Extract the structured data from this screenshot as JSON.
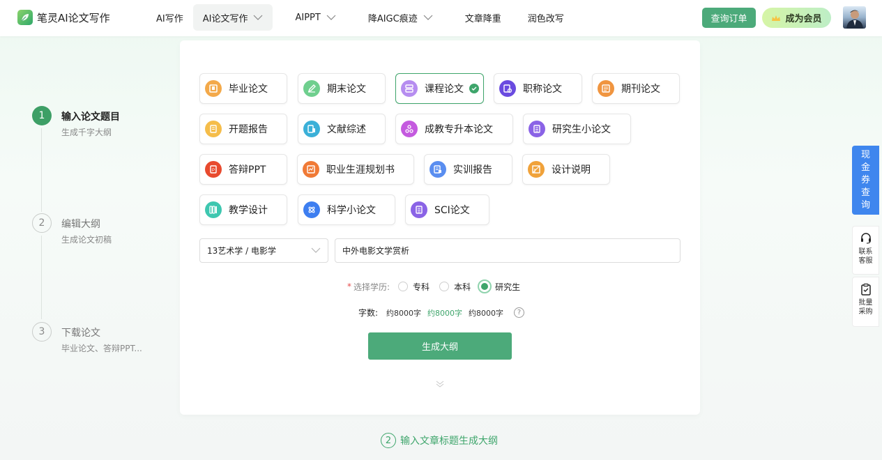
{
  "header": {
    "logo_text": "笔灵AI论文写作",
    "nav": [
      {
        "label": "AI写作",
        "dropdown": false,
        "active": false
      },
      {
        "label": "AI论文写作",
        "dropdown": true,
        "active": true
      },
      {
        "label": "AIPPT",
        "dropdown": true,
        "active": false
      },
      {
        "label": "降AIGC痕迹",
        "dropdown": true,
        "active": false
      },
      {
        "label": "文章降重",
        "dropdown": false,
        "active": false
      },
      {
        "label": "润色改写",
        "dropdown": false,
        "active": false
      }
    ],
    "order_button": "查询订单",
    "member_button": "成为会员"
  },
  "steps": [
    {
      "num": "1",
      "title": "输入论文题目",
      "sub": "生成千字大纲",
      "active": true
    },
    {
      "num": "2",
      "title": "编辑大纲",
      "sub": "生成论文初稿",
      "active": false
    },
    {
      "num": "3",
      "title": "下载论文",
      "sub": "毕业论文、答辩PPT...",
      "active": false
    }
  ],
  "paper_types": [
    {
      "label": "毕业论文",
      "icon": "thesis-icon",
      "color": "#f3a94a",
      "selected": false
    },
    {
      "label": "期末论文",
      "icon": "pen-icon",
      "color": "#6fcf8e",
      "selected": false
    },
    {
      "label": "课程论文",
      "icon": "course-icon",
      "color": "#b68df0",
      "selected": true
    },
    {
      "label": "职称论文",
      "icon": "title-paper-icon",
      "color": "#6a4be0",
      "selected": false
    },
    {
      "label": "期刊论文",
      "icon": "journal-icon",
      "color": "#f09540",
      "selected": false
    },
    {
      "label": "开题报告",
      "icon": "proposal-icon",
      "color": "#f5bd4a",
      "selected": false
    },
    {
      "label": "文献综述",
      "icon": "literature-icon",
      "color": "#3bb0d8",
      "selected": false
    },
    {
      "label": "成教专升本论文",
      "icon": "adult-edu-icon",
      "color": "#c45adf",
      "selected": false
    },
    {
      "label": "研究生小论文",
      "icon": "graduate-icon",
      "color": "#8a63e6",
      "selected": false
    },
    {
      "label": "答辩PPT",
      "icon": "ppt-icon",
      "color": "#e84a2e",
      "selected": false
    },
    {
      "label": "职业生涯规划书",
      "icon": "career-icon",
      "color": "#f07a36",
      "selected": false
    },
    {
      "label": "实训报告",
      "icon": "training-icon",
      "color": "#5a8ef0",
      "selected": false
    },
    {
      "label": "设计说明",
      "icon": "design-icon",
      "color": "#f0a23a",
      "selected": false
    },
    {
      "label": "教学设计",
      "icon": "teaching-icon",
      "color": "#3ec7b0",
      "selected": false
    },
    {
      "label": "科学小论文",
      "icon": "science-icon",
      "color": "#3d7ef0",
      "selected": false
    },
    {
      "label": "SCI论文",
      "icon": "sci-icon",
      "color": "#8a63e6",
      "selected": false
    }
  ],
  "form": {
    "subject_select": "13艺术学 / 电影学",
    "title_value": "中外电影文学赏析",
    "edu_label": "选择学历:",
    "edu_required_mark": "*",
    "edu_options": [
      "专科",
      "本科",
      "研究生"
    ],
    "edu_selected": "研究生",
    "words_label": "字数:",
    "word_options": [
      "约8000字",
      "约8000字",
      "约8000字"
    ],
    "word_selected_index": 1,
    "help_glyph": "?",
    "generate_button": "生成大纲"
  },
  "bottom_hint": {
    "num": "2",
    "text": "输入文章标题生成大纲"
  },
  "side": {
    "coupon_chars": [
      "现",
      "金",
      "券",
      "查",
      "询"
    ],
    "service_lines": [
      "联系",
      "客服"
    ],
    "bulk_lines": [
      "批量",
      "采购"
    ]
  },
  "colors": {
    "accent": "#4caa7a",
    "coupon": "#3f86ee"
  }
}
